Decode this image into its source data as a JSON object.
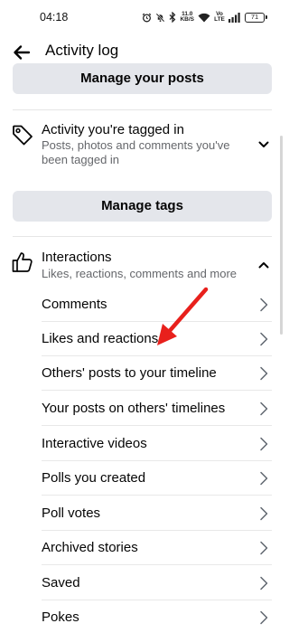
{
  "status_bar": {
    "time": "04:18",
    "speed_value": "11.0",
    "speed_unit": "KB/S",
    "network": "Vo LTE",
    "battery": "71"
  },
  "app_bar": {
    "title": "Activity log"
  },
  "manage_posts_button": "Manage your posts",
  "tagged_section": {
    "title": "Activity you're tagged in",
    "subtitle": "Posts, photos and comments you've been tagged in",
    "icon": "tag-icon"
  },
  "manage_tags_button": "Manage tags",
  "interactions_section": {
    "title": "Interactions",
    "subtitle": "Likes, reactions, comments and more",
    "icon": "thumbs-up-icon"
  },
  "items": [
    {
      "label": "Comments"
    },
    {
      "label": "Likes and reactions"
    },
    {
      "label": "Others' posts to your timeline"
    },
    {
      "label": "Your posts on others' timelines"
    },
    {
      "label": "Interactive videos"
    },
    {
      "label": "Polls you created"
    },
    {
      "label": "Poll votes"
    },
    {
      "label": "Archived stories"
    },
    {
      "label": "Saved"
    },
    {
      "label": "Pokes"
    }
  ],
  "colors": {
    "arrow": "#e8201c",
    "button_bg": "#e4e6eb",
    "secondary_text": "#65676b"
  }
}
